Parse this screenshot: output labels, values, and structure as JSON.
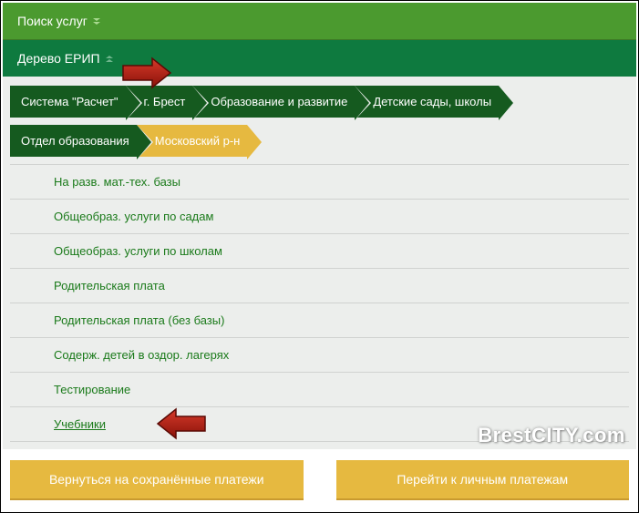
{
  "panels": {
    "search": {
      "title": "Поиск услуг"
    },
    "tree": {
      "title": "Дерево ЕРИП"
    }
  },
  "breadcrumbs": {
    "row1": [
      "Система \"Расчет\"",
      "г. Брест",
      "Образование и развитие",
      "Детские сады, школы"
    ],
    "row2": [
      "Отдел образования",
      "Московский р-н"
    ]
  },
  "services": [
    "На разв. мат.-тех. базы",
    "Общеобраз. услуги по садам",
    "Общеобраз. услуги по школам",
    "Родительская плата",
    "Родительская плата (без базы)",
    "Содерж. детей в оздор. лагерях",
    "Тестирование",
    "Учебники"
  ],
  "buttons": {
    "back": "Вернуться на сохранённые платежи",
    "forward": "Перейти к личным платежам"
  },
  "watermark": "BrestCITY.com"
}
